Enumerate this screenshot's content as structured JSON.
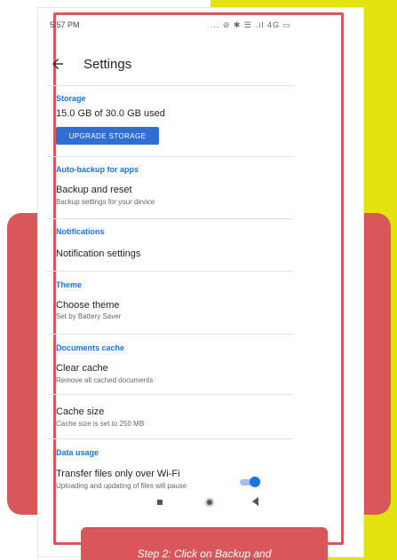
{
  "status_bar": {
    "time": "5:57 PM",
    "icons_text": "... ⊘ ✱ ☰ .ıl 4G ▭"
  },
  "app_bar": {
    "title": "Settings"
  },
  "storage": {
    "header": "Storage",
    "usage": "15.0 GB of 30.0 GB used",
    "upgrade_label": "UPGRADE STORAGE"
  },
  "autobackup": {
    "header": "Auto-backup for apps",
    "title": "Backup and reset",
    "subtitle": "Backup settings for your device"
  },
  "notifications": {
    "header": "Notifications",
    "title": "Notification settings"
  },
  "theme": {
    "header": "Theme",
    "title": "Choose theme",
    "subtitle": "Set by Battery Saver"
  },
  "documents_cache": {
    "header": "Documents cache",
    "title": "Clear cache",
    "subtitle": "Remove all cached documents"
  },
  "cache_size": {
    "title": "Cache size",
    "subtitle": "Cache size is set to 250 MB"
  },
  "data_usage": {
    "header": "Data usage",
    "title": "Transfer files only over Wi-Fi",
    "subtitle": "Uploading and updating of files will pause",
    "toggle_on": true
  },
  "caption": {
    "text": "Step 2: Click on Backup and"
  },
  "colors": {
    "accent": "#1a73e8",
    "frame": "#d9575a",
    "band": "#e3e40f"
  }
}
